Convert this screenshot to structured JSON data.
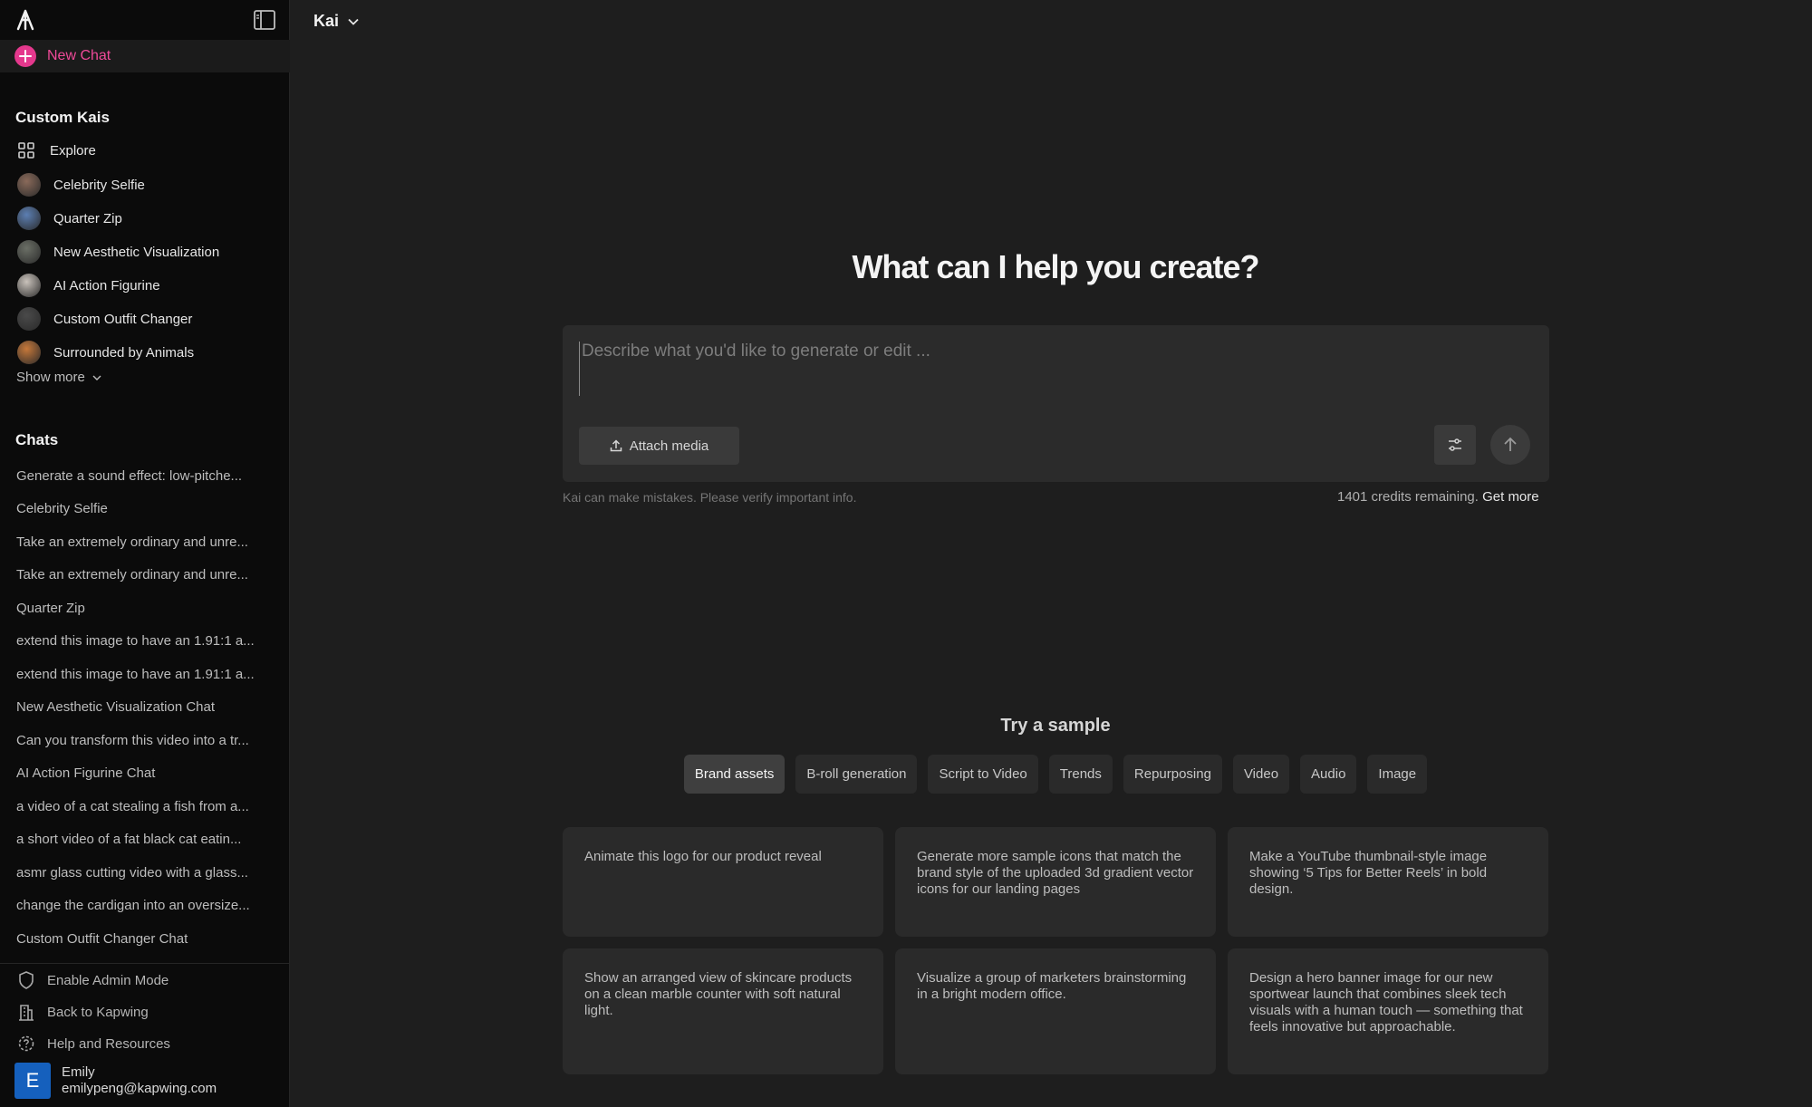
{
  "sidebar": {
    "new_chat_label": "New Chat",
    "custom_kais_title": "Custom Kais",
    "explore_label": "Explore",
    "custom_kais": [
      {
        "label": "Celebrity Selfie",
        "color": "#8a6a5a"
      },
      {
        "label": "Quarter Zip",
        "color": "#5c7fb3"
      },
      {
        "label": "New Aesthetic Visualization",
        "color": "#6b6f66"
      },
      {
        "label": "AI Action Figurine",
        "color": "#c9c2bb"
      },
      {
        "label": "Custom Outfit Changer",
        "color": "#4a4a4a"
      },
      {
        "label": "Surrounded by Animals",
        "color": "#c6783a"
      }
    ],
    "show_more_label": "Show more",
    "chats_title": "Chats",
    "chats": [
      "Generate a sound effect: low-pitche...",
      "Celebrity Selfie",
      "Take an extremely ordinary and unre...",
      "Take an extremely ordinary and unre...",
      "Quarter Zip",
      "extend this image to have an 1.91:1 a...",
      "extend this image to have an 1.91:1 a...",
      "New Aesthetic Visualization Chat",
      "Can you transform this video into a tr...",
      "AI Action Figurine Chat",
      "a video of a cat stealing a fish from a...",
      "a short video of a fat black cat eatin...",
      "asmr glass cutting video with a glass...",
      "change the cardigan into an oversize...",
      "Custom Outfit Changer Chat"
    ],
    "footer": {
      "admin_label": "Enable Admin Mode",
      "back_label": "Back to Kapwing",
      "help_label": "Help and Resources"
    },
    "user": {
      "initial": "E",
      "name": "Emily",
      "email": "emilypeng@kapwing.com"
    }
  },
  "header": {
    "model_label": "Kai"
  },
  "main": {
    "headline": "What can I help you create?",
    "prompt_placeholder": "Describe what you'd like to generate or edit ...",
    "attach_label": "Attach media",
    "disclaimer": "Kai can make mistakes. Please verify important info.",
    "credits_text": "1401 credits remaining.",
    "get_more_label": "Get more",
    "try_title": "Try a sample",
    "chips": [
      "Brand assets",
      "B-roll generation",
      "Script to Video",
      "Trends",
      "Repurposing",
      "Video",
      "Audio",
      "Image"
    ],
    "active_chip": "Brand assets",
    "cards": [
      "Animate this logo for our product reveal",
      "Generate more sample icons that match the brand style of the uploaded 3d gradient vector icons for our landing pages",
      "Make a YouTube thumbnail-style image showing ‘5 Tips for Better Reels’ in bold design.",
      "Show an arranged view of skincare products on a clean marble counter with soft natural light.",
      "Visualize a group of marketers brainstorming in a bright modern office.",
      "Design a hero banner image for our new sportwear launch that combines sleek tech visuals with a human touch — something that feels innovative but approachable."
    ]
  },
  "colors": {
    "accent": "#e4388d",
    "background": "#1e1e1e",
    "sidebar": "#0b0b0b",
    "avatar": "#1560bd"
  }
}
